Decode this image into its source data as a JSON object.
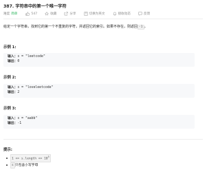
{
  "problem": {
    "title": "387. 字符串中的第一个唯一字符",
    "difficulty_prefix": "难度",
    "difficulty": "简单",
    "likes": "547",
    "favorite_label": "收藏",
    "share_label": "分享",
    "switch_lang_label": "切换为英文",
    "notify_label": "接收动态",
    "feedback_label": "反馈"
  },
  "description": {
    "part1": "给定一个字符串，找到它的第一个不重复的字符，并返回它的索引。如果不存在，则返回",
    "code": "-1",
    "part2": "。"
  },
  "examples": [
    {
      "title": "示例 1:",
      "input_label": "输入：",
      "input": "s = \"leetcode\"",
      "output_label": "输出：",
      "output": "0"
    },
    {
      "title": "示例 2:",
      "input_label": "输入：",
      "input": "s = \"loveleetcode\"",
      "output_label": "输出：",
      "output": "2"
    },
    {
      "title": "示例 3:",
      "input_label": "输入：",
      "input": "s = \"aabb\"",
      "output_label": "输出：",
      "output": "-1"
    }
  ],
  "tips": {
    "title": "提示:",
    "items": [
      {
        "prefix": "1 <= s.length <= 10",
        "sup": "5"
      },
      {
        "prefix": "s",
        "text": " 只包含小写字母"
      }
    ]
  },
  "colors": {
    "easy": "#2db55d",
    "meta_gray": "#8c8c8c",
    "code_bg": "#f7f8fa"
  }
}
